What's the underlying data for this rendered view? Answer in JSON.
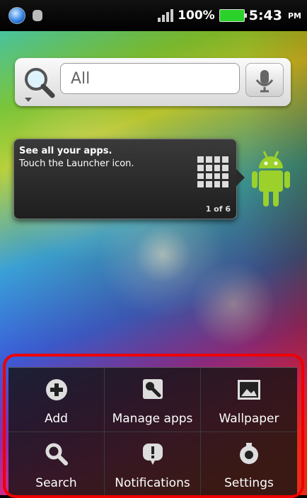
{
  "status_bar": {
    "battery": "100%",
    "time": "5:43",
    "ampm": "PM"
  },
  "search": {
    "placeholder": "All"
  },
  "tip": {
    "title": "See all your apps.",
    "body": "Touch the Launcher icon.",
    "counter": "1 of 6"
  },
  "menu": {
    "items": [
      {
        "label": "Add",
        "icon": "add-icon"
      },
      {
        "label": "Manage apps",
        "icon": "wrench-icon"
      },
      {
        "label": "Wallpaper",
        "icon": "wallpaper-icon"
      },
      {
        "label": "Search",
        "icon": "search-icon"
      },
      {
        "label": "Notifications",
        "icon": "notifications-icon"
      },
      {
        "label": "Settings",
        "icon": "gear-icon"
      }
    ]
  },
  "colors": {
    "highlight": "#e00000",
    "battery": "#2ad12a",
    "android_green": "#9bd12a"
  }
}
